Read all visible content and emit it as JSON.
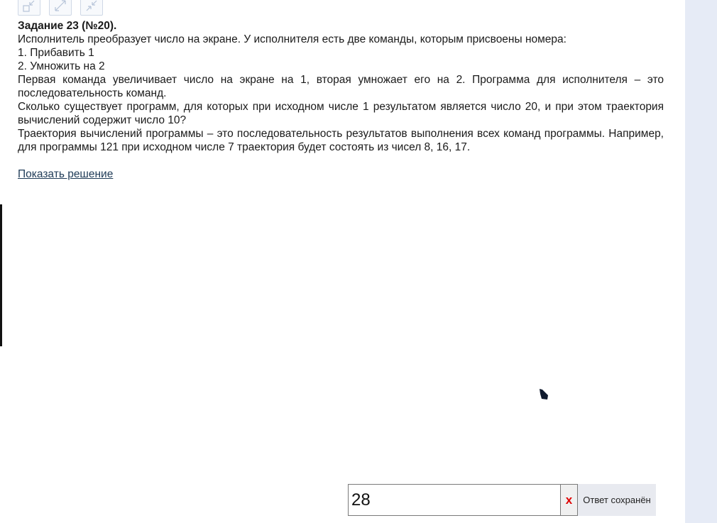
{
  "toolbar": {
    "icons": [
      "shrink-icon",
      "expand-icon",
      "collapse-icon"
    ]
  },
  "task": {
    "title": "Задание 23 (№20).",
    "intro": "Исполнитель преобразует число на экране. У исполнителя есть две команды, которым присвоены номера:",
    "command1": "1. Прибавить 1",
    "command2": "2. Умножить на 2",
    "description": "Первая команда увеличивает число на экране на 1, вторая умножает его на 2. Программа для исполнителя – это последовательность команд.",
    "question": "Сколько существует программ, для которых при исходном числе 1 результатом является число 20, и при этом траектория вычислений содержит число 10?",
    "note": "Траектория вычислений программы – это последовательность результатов выполнения всех команд программы. Например, для программы 121 при исходном числе 7 траектория будет состоять из чисел 8, 16, 17."
  },
  "solution": {
    "link_label": "Показать решение"
  },
  "answer": {
    "value": "28",
    "clear_label": "x",
    "status": "Ответ сохранён"
  },
  "colors": {
    "link": "#1f3b57",
    "clear": "#e00000",
    "side_panel": "#e6ebf6"
  }
}
